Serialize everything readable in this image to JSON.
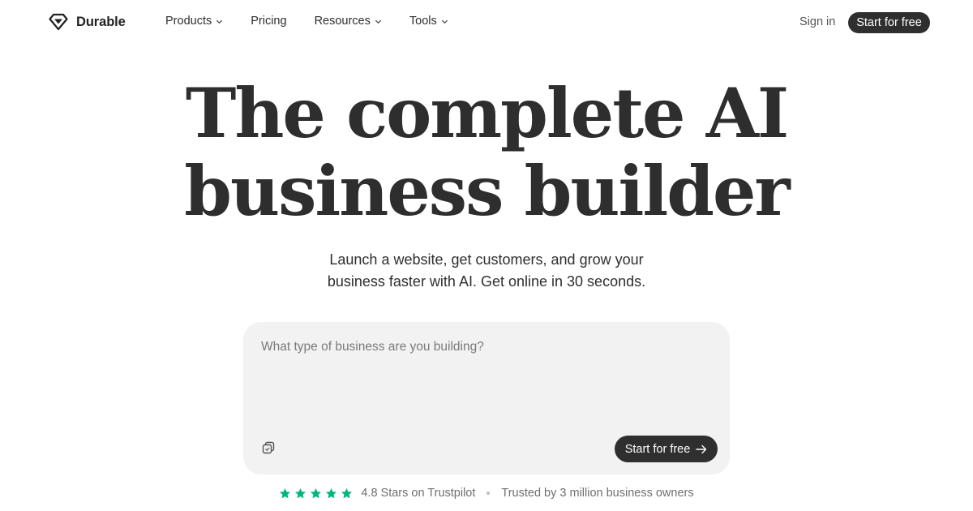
{
  "brand": {
    "name": "Durable",
    "logo_icon": "diamond-icon"
  },
  "nav": {
    "items": [
      {
        "label": "Products",
        "has_dropdown": true
      },
      {
        "label": "Pricing",
        "has_dropdown": false
      },
      {
        "label": "Resources",
        "has_dropdown": true
      },
      {
        "label": "Tools",
        "has_dropdown": true
      }
    ],
    "sign_in": "Sign in",
    "cta": "Start for free"
  },
  "hero": {
    "title_lines": [
      "The complete AI",
      "business builder"
    ],
    "subtitle_lines": [
      "Launch a website, get customers, and grow your",
      "business faster with AI. Get online in 30 seconds."
    ]
  },
  "prompt": {
    "placeholder": "What type of business are you building?",
    "value": "",
    "attach_icon": "copy-icon",
    "submit_label": "Start for free",
    "submit_icon": "arrow-right-icon"
  },
  "trust": {
    "stars": 5,
    "rating_text": "4.8 Stars on Trustpilot",
    "users_text": "Trusted by 3 million business owners"
  },
  "colors": {
    "text": "#2e2e2e",
    "button_bg": "#2f2f2f",
    "prompt_bg": "#f2f2f2",
    "star": "#00b67a",
    "muted": "#6f6f6f"
  }
}
